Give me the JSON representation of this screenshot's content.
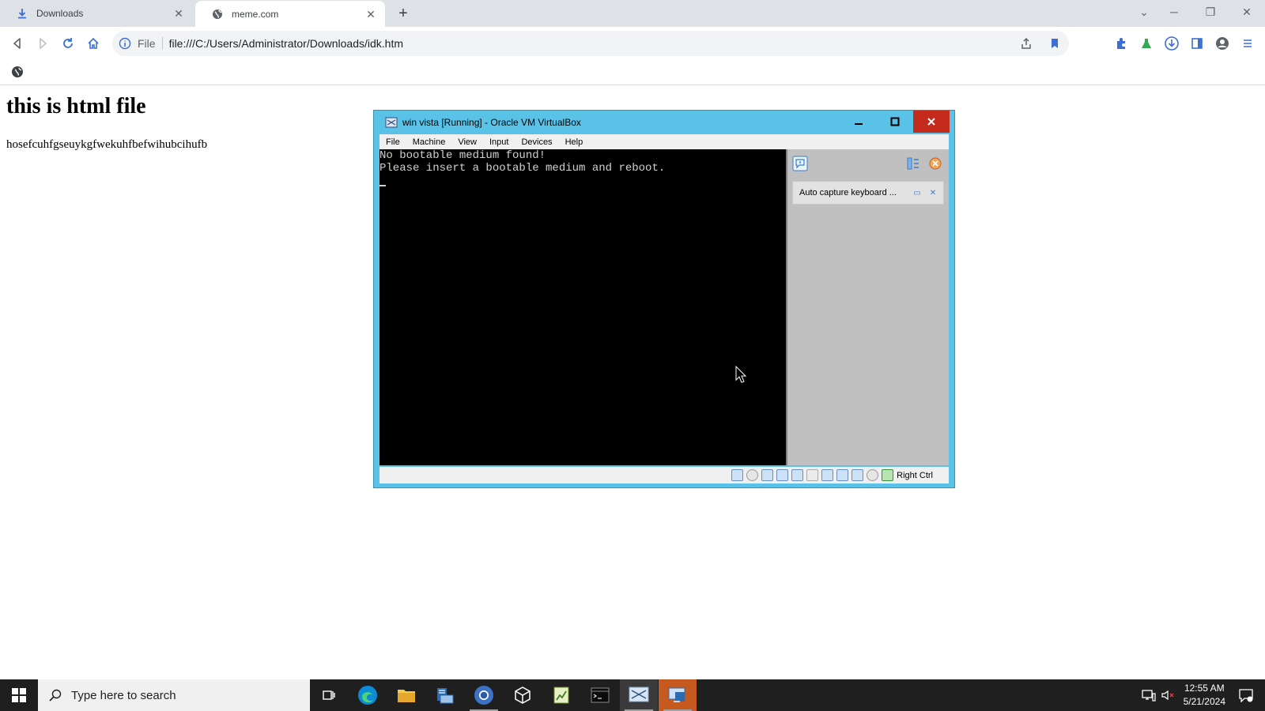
{
  "browser": {
    "tabs": [
      {
        "title": "Downloads",
        "icon": "download-icon"
      },
      {
        "title": "meme.com",
        "icon": "globe-icon"
      }
    ],
    "omnibox": {
      "scheme_label": "File",
      "url": "file:///C:/Users/Administrator/Downloads/idk.htm"
    }
  },
  "page": {
    "heading": "this is html file",
    "paragraph": "hosefcuhfgseuykgfwekuhfbefwihubcihufb"
  },
  "virtualbox": {
    "title": "win vista  [Running] - Oracle VM VirtualBox",
    "menu": [
      "File",
      "Machine",
      "View",
      "Input",
      "Devices",
      "Help"
    ],
    "screen_lines": [
      "No bootable medium found!",
      "Please insert a bootable medium and reboot."
    ],
    "notification": "Auto capture keyboard ...",
    "host_key": "Right Ctrl"
  },
  "taskbar": {
    "search_placeholder": "Type here to search",
    "time": "12:55 AM",
    "date": "5/21/2024",
    "apps": [
      "task-view",
      "edge",
      "file-explorer",
      "server-manager",
      "chrome",
      "virtualbox",
      "notepad-plus",
      "terminal",
      "vbox-vm",
      "remote-desktop"
    ]
  },
  "colors": {
    "vbox_frame": "#5bc2e7",
    "vbox_close": "#c42b1c",
    "taskbar": "#1f1f1f"
  }
}
